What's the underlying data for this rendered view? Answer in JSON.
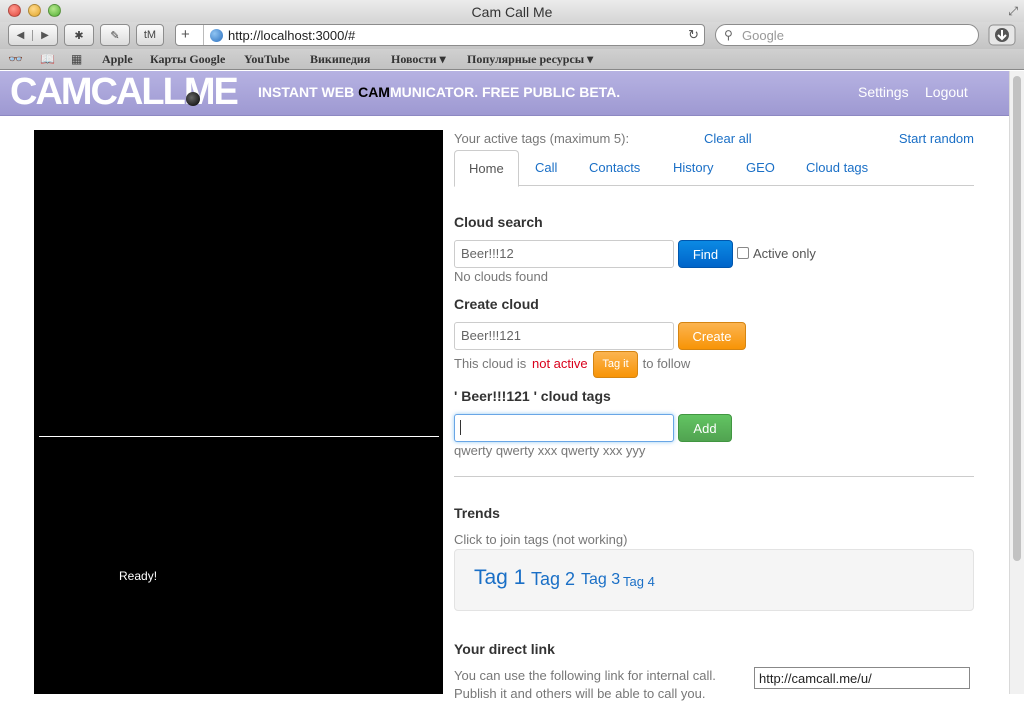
{
  "browser": {
    "window_title": "Cam Call Me",
    "url": "http://localhost:3000/#",
    "search_placeholder": "Google",
    "tm_button": "tM",
    "bookmarks": [
      "Apple",
      "Карты Google",
      "YouTube",
      "Википедия",
      "Новости ▾",
      "Популярные ресурсы ▾"
    ]
  },
  "header": {
    "logo": "CAMCALLME",
    "tagline_before": "INSTANT WEB ",
    "tagline_highlight": "CAM",
    "tagline_after": "MUNICATOR. FREE PUBLIC BETA.",
    "settings": "Settings",
    "logout": "Logout"
  },
  "video": {
    "status": "Ready!"
  },
  "tags_bar": {
    "label": "Your active tags (maximum 5):",
    "clear_all": "Clear all",
    "start_random": "Start random"
  },
  "tabs": [
    {
      "label": "Home",
      "active": true
    },
    {
      "label": "Call"
    },
    {
      "label": "Contacts"
    },
    {
      "label": "History"
    },
    {
      "label": "GEO"
    },
    {
      "label": "Cloud tags"
    }
  ],
  "cloud_search": {
    "title": "Cloud search",
    "input_value": "Beer!!!12",
    "find_button": "Find",
    "active_only_label": "Active only",
    "result": "No clouds found"
  },
  "create_cloud": {
    "title": "Create cloud",
    "input_value": "Beer!!!121",
    "create_button": "Create",
    "status_prefix": "This cloud is ",
    "status_state": "not active",
    "tag_button": "Tag it",
    "status_suffix": " to follow"
  },
  "cloud_tags": {
    "title": "' Beer!!!121 ' cloud tags",
    "input_value": "",
    "add_button": "Add",
    "tags_text": "qwerty qwerty xxx qwerty xxx yyy"
  },
  "trends": {
    "title": "Trends",
    "hint": "Click to join tags (not working)",
    "tags": [
      "Tag 1",
      "Tag 2",
      "Tag 3",
      "Tag 4"
    ]
  },
  "direct_link": {
    "title": "Your direct link",
    "description_line1": "You can use the following link for internal call.",
    "description_line2": "Publish it and others will be able to call you.",
    "link_value": "http://camcall.me/u/"
  },
  "colors": {
    "header_bg": "#a9a5da",
    "link": "#1a6fc6",
    "find_button": "#0074cc",
    "create_button": "#f89406",
    "add_button": "#51a351",
    "inactive_red": "#d9001b"
  }
}
